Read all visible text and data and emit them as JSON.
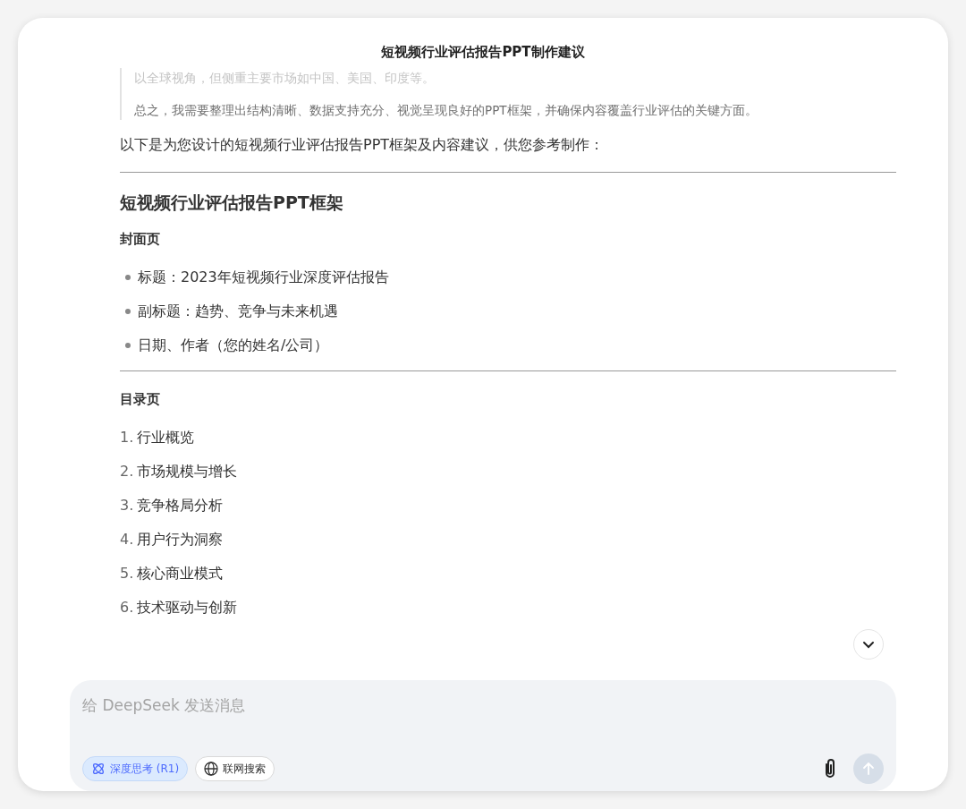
{
  "title": "短视频行业评估报告PPT制作建议",
  "thinking": [
    {
      "text": "以全球视角，但侧重主要市场如中国、美国、印度等。",
      "faded": true
    },
    {
      "text": "总之，我需要整理出结构清晰、数据支持充分、视觉呈现良好的PPT框架，并确保内容覆盖行业评估的关键方面。",
      "faded": false
    }
  ],
  "intro": "以下是为您设计的短视频行业评估报告PPT框架及内容建议，供您参考制作：",
  "blocks": [
    {
      "kind": "rule"
    },
    {
      "kind": "heading",
      "text": "短视频行业评估报告PPT框架"
    },
    {
      "kind": "subheading",
      "text": "封面页"
    },
    {
      "kind": "bullets",
      "items": [
        "标题：2023年短视频行业深度评估报告",
        "副标题：趋势、竞争与未来机遇",
        "日期、作者（您的姓名/公司）"
      ]
    },
    {
      "kind": "rule"
    },
    {
      "kind": "subheading",
      "text": "目录页"
    },
    {
      "kind": "numbered",
      "items": [
        {
          "marker": "1.",
          "text": "行业概览"
        },
        {
          "marker": "2.",
          "text": "市场规模与增长"
        },
        {
          "marker": "3.",
          "text": "竞争格局分析"
        },
        {
          "marker": "4.",
          "text": "用户行为洞察"
        },
        {
          "marker": "5.",
          "text": "核心商业模式"
        },
        {
          "marker": "6.",
          "text": "技术驱动与创新"
        }
      ]
    }
  ],
  "composer": {
    "placeholder": "给 DeepSeek 发送消息",
    "toggles": [
      {
        "label": "深度思考 (R1)",
        "kind": "think",
        "selected": true
      },
      {
        "label": "联网搜索",
        "kind": "web",
        "selected": false
      }
    ],
    "send_disabled": true
  }
}
